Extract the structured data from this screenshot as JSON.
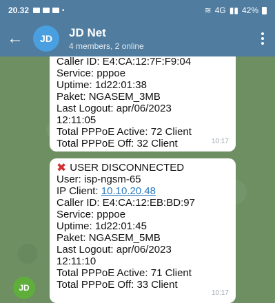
{
  "status_bar": {
    "time": "20.32",
    "battery": "42%",
    "network": "4G"
  },
  "header": {
    "avatar_initials": "JD",
    "title": "JD Net",
    "subtitle": "4 members, 2 online"
  },
  "messages": [
    {
      "lines": [
        "Caller ID: E4:CA:12:7F:F9:04",
        "Service: pppoe",
        "Uptime: 1d22:01:38",
        "Paket: NGASEM_3MB",
        "Last Logout: apr/06/2023",
        "12:11:05",
        "Total PPPoE Active: 72 Client",
        "Total PPPoE Off: 32 Client"
      ],
      "time": "10:17"
    },
    {
      "header": "USER DISCONNECTED",
      "user": "User: isp-ngsm-65",
      "ip_label": "IP Client: ",
      "ip_value": "10.10.20.48",
      "lines": [
        "Caller ID: E4:CA:12:EB:BD:97",
        "Service: pppoe",
        "Uptime: 1d22:01:45",
        "Paket: NGASEM_5MB",
        "Last Logout: apr/06/2023",
        "12:11:10",
        "Total PPPoE Active: 71 Client",
        "Total PPPoE Off: 33 Client"
      ],
      "time": "10:17"
    }
  ],
  "sender_initials": "JD"
}
